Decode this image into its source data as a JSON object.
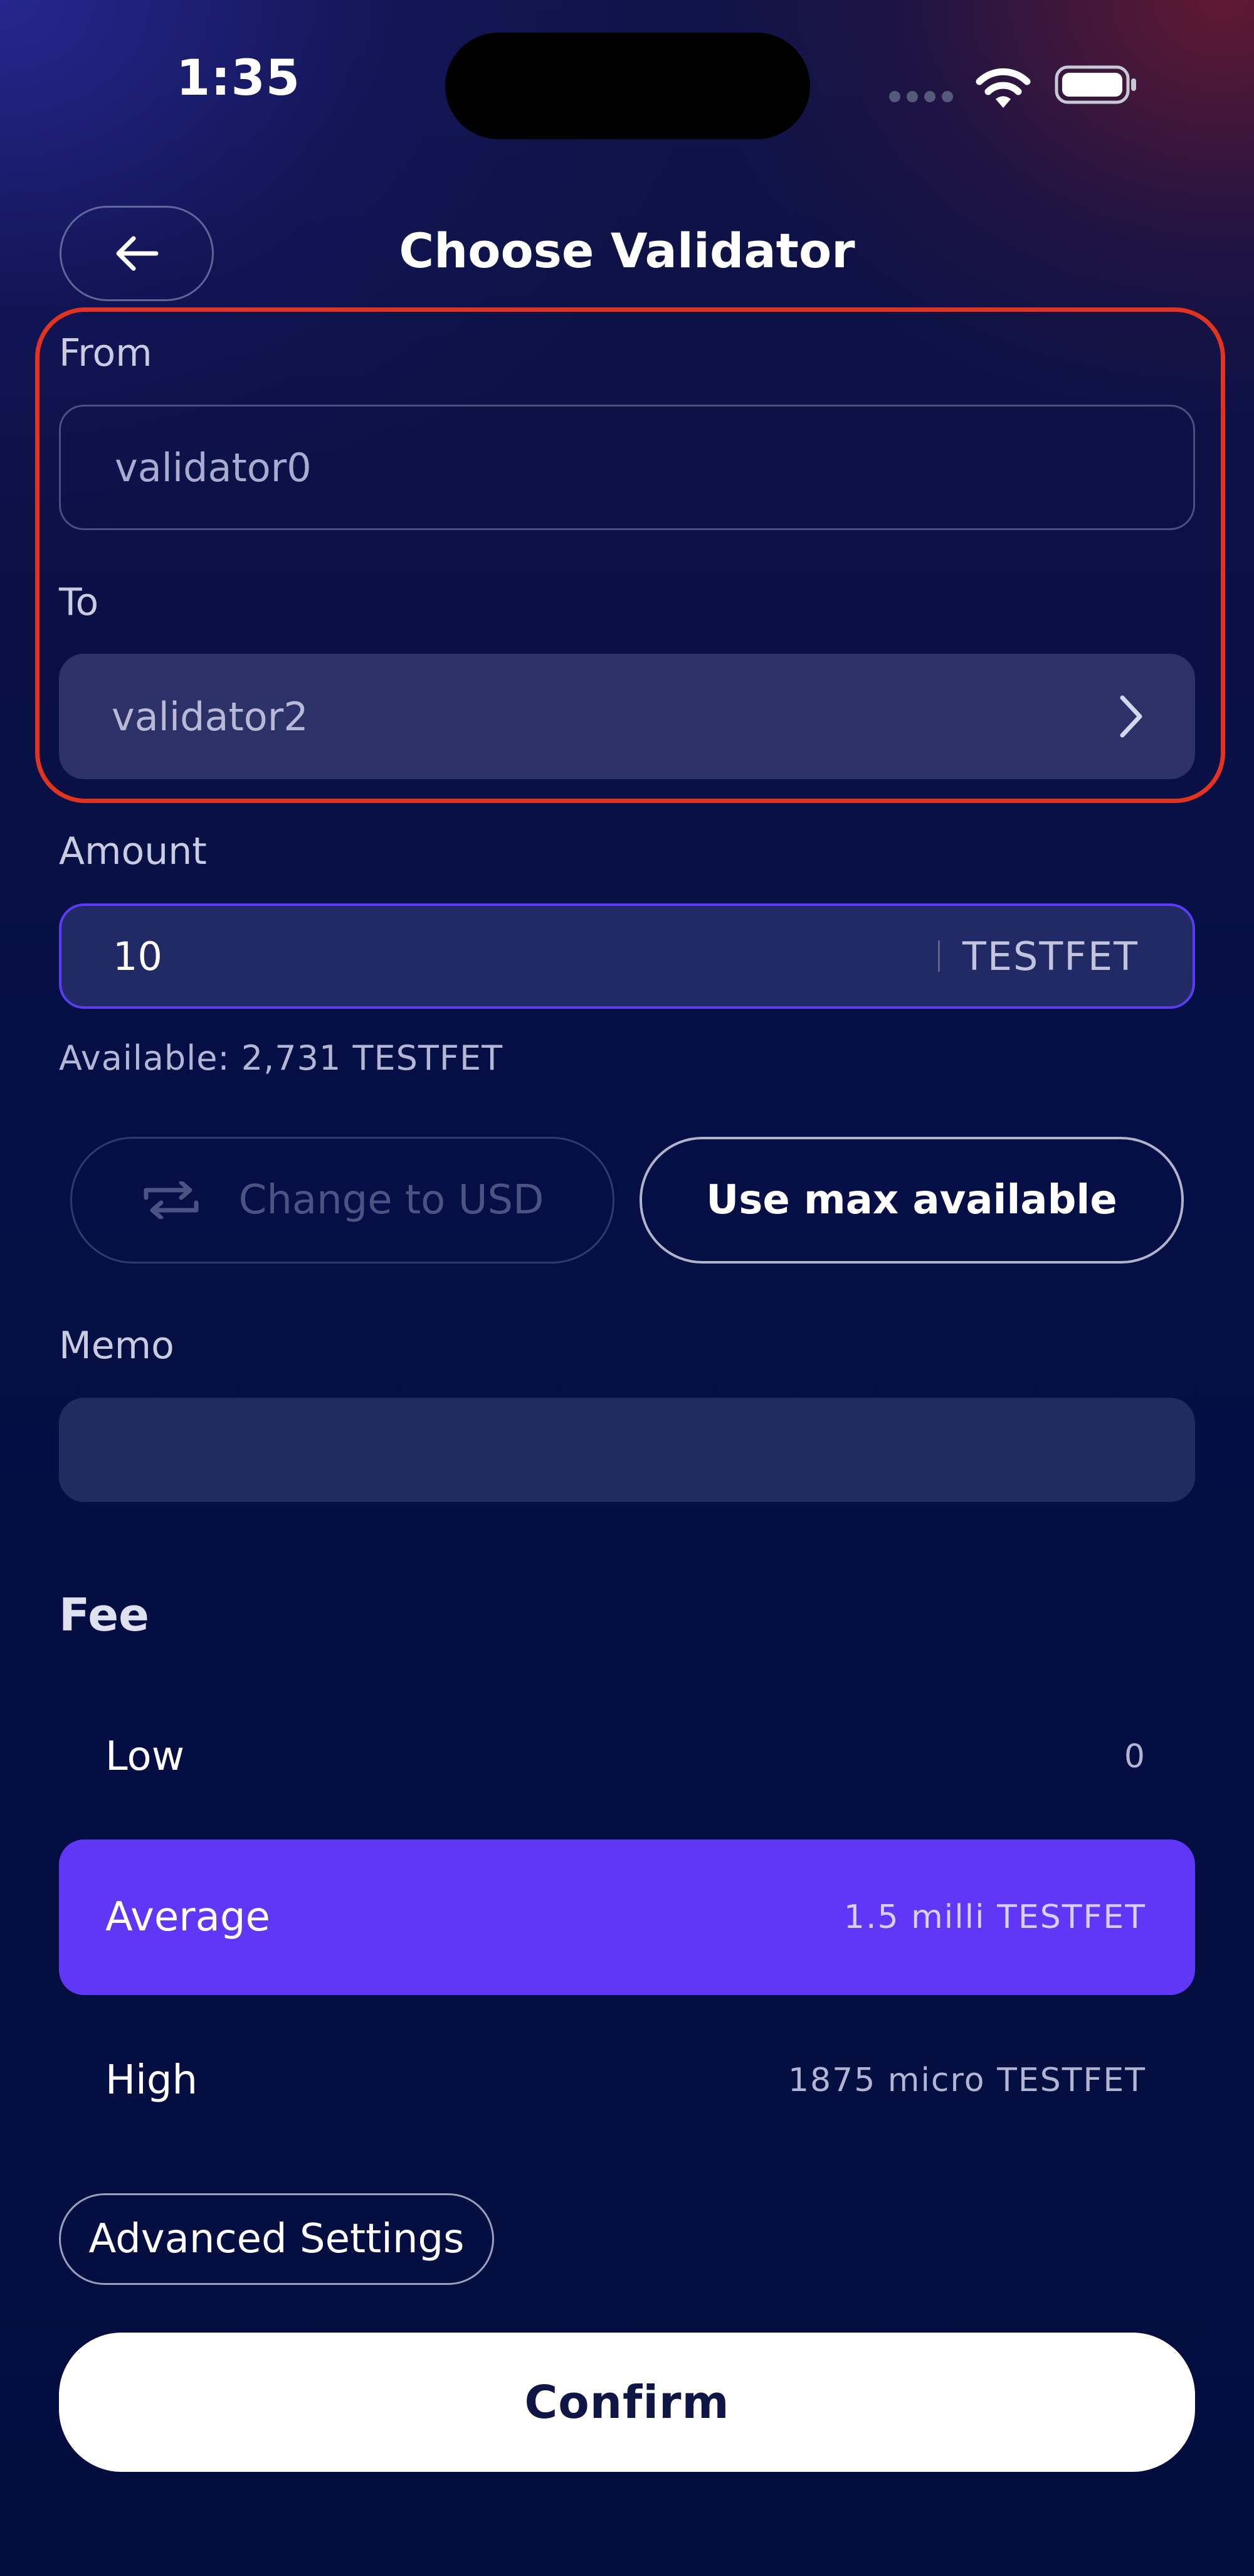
{
  "status_bar": {
    "time": "1:35"
  },
  "header": {
    "title": "Choose Validator",
    "back_icon": "arrow-left-icon"
  },
  "from": {
    "label": "From",
    "value": "validator0"
  },
  "to": {
    "label": "To",
    "value": "validator2",
    "icon": "chevron-right-icon"
  },
  "amount": {
    "label": "Amount",
    "value": "10",
    "unit": "TESTFET",
    "available": "Available: 2,731 TESTFET"
  },
  "buttons": {
    "change_to_usd": "Change to USD",
    "use_max": "Use max available",
    "advanced_settings": "Advanced Settings",
    "confirm": "Confirm"
  },
  "memo": {
    "label": "Memo",
    "value": ""
  },
  "fee": {
    "title": "Fee",
    "options": [
      {
        "name": "Low",
        "value": "0"
      },
      {
        "name": "Average",
        "value": "1.5 milli TESTFET",
        "selected": true
      },
      {
        "name": "High",
        "value": "1875 micro TESTFET"
      }
    ]
  },
  "colors": {
    "accent": "#6036f7",
    "highlight_border": "#e2331f",
    "background": "#030d3e"
  }
}
